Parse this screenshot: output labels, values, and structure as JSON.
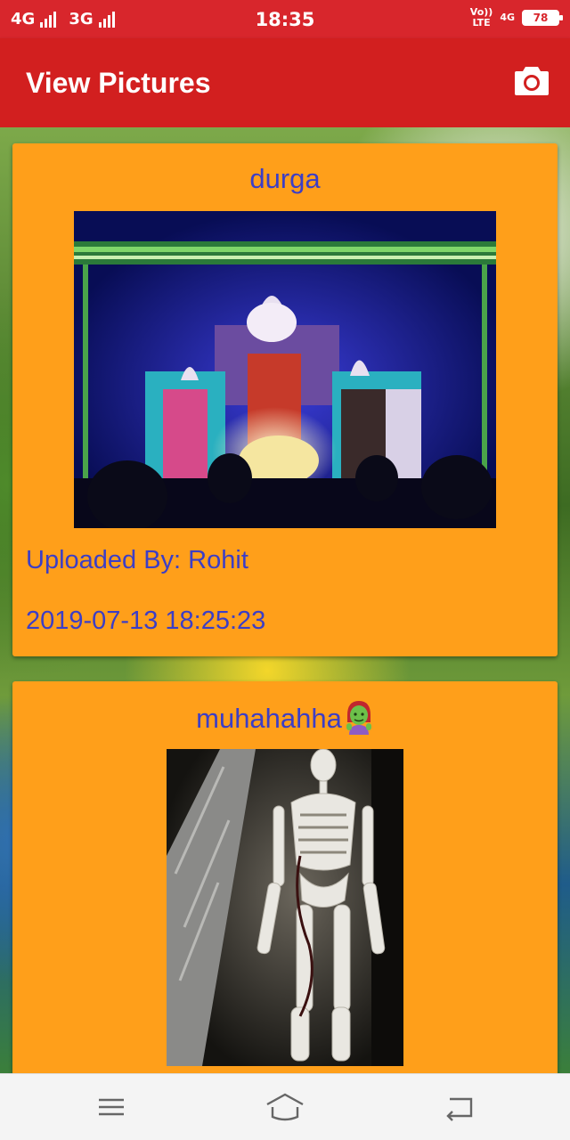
{
  "status_bar": {
    "network_1": "4G",
    "network_2": "3G",
    "time": "18:35",
    "volte_top": "Vo))",
    "volte_bottom": "LTE",
    "network_right": "4G",
    "battery": "78"
  },
  "app_bar": {
    "title": "View Pictures",
    "camera_icon": "camera-icon"
  },
  "posts": [
    {
      "title": "durga",
      "image_icon": "durga-idol-photo",
      "uploaded_by": "Uploaded By: Rohit",
      "uploaded_at": "2019-07-13 18:25:23"
    },
    {
      "title": "muhahahha",
      "title_emoji": "zombie-emoji",
      "image_icon": "skeleton-photo"
    }
  ],
  "nav_bar": {
    "menu_icon": "menu-icon",
    "home_icon": "home-icon",
    "back_icon": "back-icon"
  },
  "colors": {
    "status_bar": "#d8262c",
    "app_bar": "#d21f1f",
    "card_background": "#ff9f1a",
    "card_text": "#3c3ec6"
  }
}
